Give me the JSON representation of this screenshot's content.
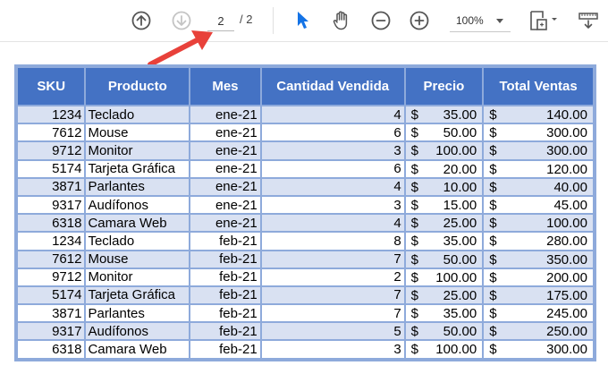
{
  "toolbar": {
    "page_current": "2",
    "page_total": "/ 2",
    "zoom": "100%",
    "icons": [
      "page-up-icon",
      "page-down-icon",
      "select-arrow-icon",
      "hand-tool-icon",
      "zoom-out-icon",
      "zoom-in-icon",
      "fit-page-icon",
      "more-tools-icon"
    ]
  },
  "table": {
    "headers": [
      "SKU",
      "Producto",
      "Mes",
      "Cantidad Vendida",
      "Precio",
      "Total Ventas"
    ],
    "currency": "$",
    "rows": [
      {
        "sku": "1234",
        "producto": "Teclado",
        "mes": "ene-21",
        "cantidad": "4",
        "precio": "35.00",
        "total": "140.00"
      },
      {
        "sku": "7612",
        "producto": "Mouse",
        "mes": "ene-21",
        "cantidad": "6",
        "precio": "50.00",
        "total": "300.00"
      },
      {
        "sku": "9712",
        "producto": "Monitor",
        "mes": "ene-21",
        "cantidad": "3",
        "precio": "100.00",
        "total": "300.00"
      },
      {
        "sku": "5174",
        "producto": "Tarjeta Gráfica",
        "mes": "ene-21",
        "cantidad": "6",
        "precio": "20.00",
        "total": "120.00"
      },
      {
        "sku": "3871",
        "producto": "Parlantes",
        "mes": "ene-21",
        "cantidad": "4",
        "precio": "10.00",
        "total": "40.00"
      },
      {
        "sku": "9317",
        "producto": "Audífonos",
        "mes": "ene-21",
        "cantidad": "3",
        "precio": "15.00",
        "total": "45.00"
      },
      {
        "sku": "6318",
        "producto": "Camara Web",
        "mes": "ene-21",
        "cantidad": "4",
        "precio": "25.00",
        "total": "100.00"
      },
      {
        "sku": "1234",
        "producto": "Teclado",
        "mes": "feb-21",
        "cantidad": "8",
        "precio": "35.00",
        "total": "280.00"
      },
      {
        "sku": "7612",
        "producto": "Mouse",
        "mes": "feb-21",
        "cantidad": "7",
        "precio": "50.00",
        "total": "350.00"
      },
      {
        "sku": "9712",
        "producto": "Monitor",
        "mes": "feb-21",
        "cantidad": "2",
        "precio": "100.00",
        "total": "200.00"
      },
      {
        "sku": "5174",
        "producto": "Tarjeta Gráfica",
        "mes": "feb-21",
        "cantidad": "7",
        "precio": "25.00",
        "total": "175.00"
      },
      {
        "sku": "3871",
        "producto": "Parlantes",
        "mes": "feb-21",
        "cantidad": "7",
        "precio": "35.00",
        "total": "245.00"
      },
      {
        "sku": "9317",
        "producto": "Audífonos",
        "mes": "feb-21",
        "cantidad": "5",
        "precio": "50.00",
        "total": "250.00"
      },
      {
        "sku": "6318",
        "producto": "Camara Web",
        "mes": "feb-21",
        "cantidad": "3",
        "precio": "100.00",
        "total": "300.00"
      }
    ]
  },
  "colors": {
    "header_bg": "#4472c4",
    "band_bg": "#d9e1f2",
    "border": "#8eaadb",
    "annotation_arrow": "#e8413a",
    "select_tool": "#1473e6"
  }
}
